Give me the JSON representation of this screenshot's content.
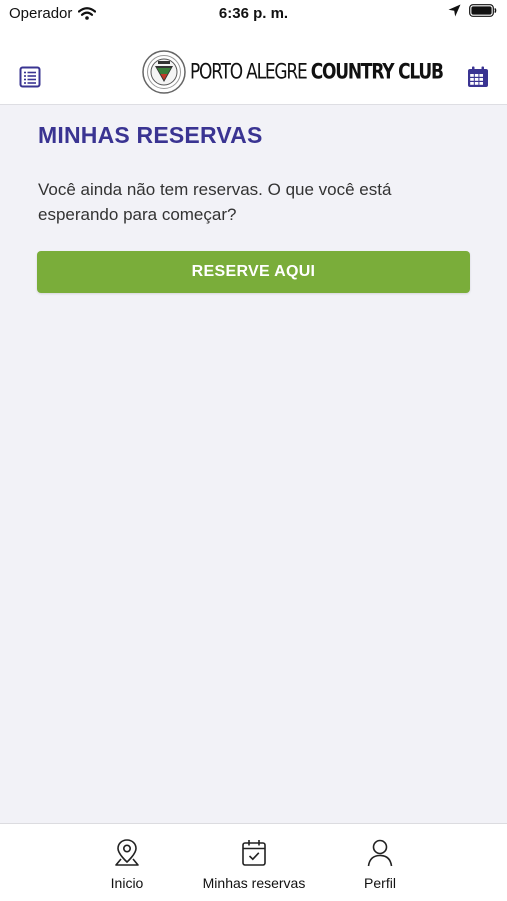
{
  "status_bar": {
    "carrier": "Operador",
    "time": "6:36 p. m."
  },
  "header": {
    "logo_text_regular": "PORTO ALEGRE",
    "logo_text_bold": "COUNTRY CLUB",
    "left_icon": "list-icon",
    "right_icon": "calendar-icon"
  },
  "main": {
    "title": "MINHAS RESERVAS",
    "message": "Você ainda não tem reservas. O que você está esperando para começar?",
    "button_label": "RESERVE AQUI"
  },
  "tab_bar": {
    "tabs": [
      {
        "label": "Inicio",
        "icon": "location-pin-icon"
      },
      {
        "label": "Minhas reservas",
        "icon": "calendar-check-icon"
      },
      {
        "label": "Perfil",
        "icon": "user-icon"
      }
    ]
  },
  "colors": {
    "primary": "#3a3492",
    "accent_green": "#7aad3a",
    "background": "#f2f2f7"
  }
}
